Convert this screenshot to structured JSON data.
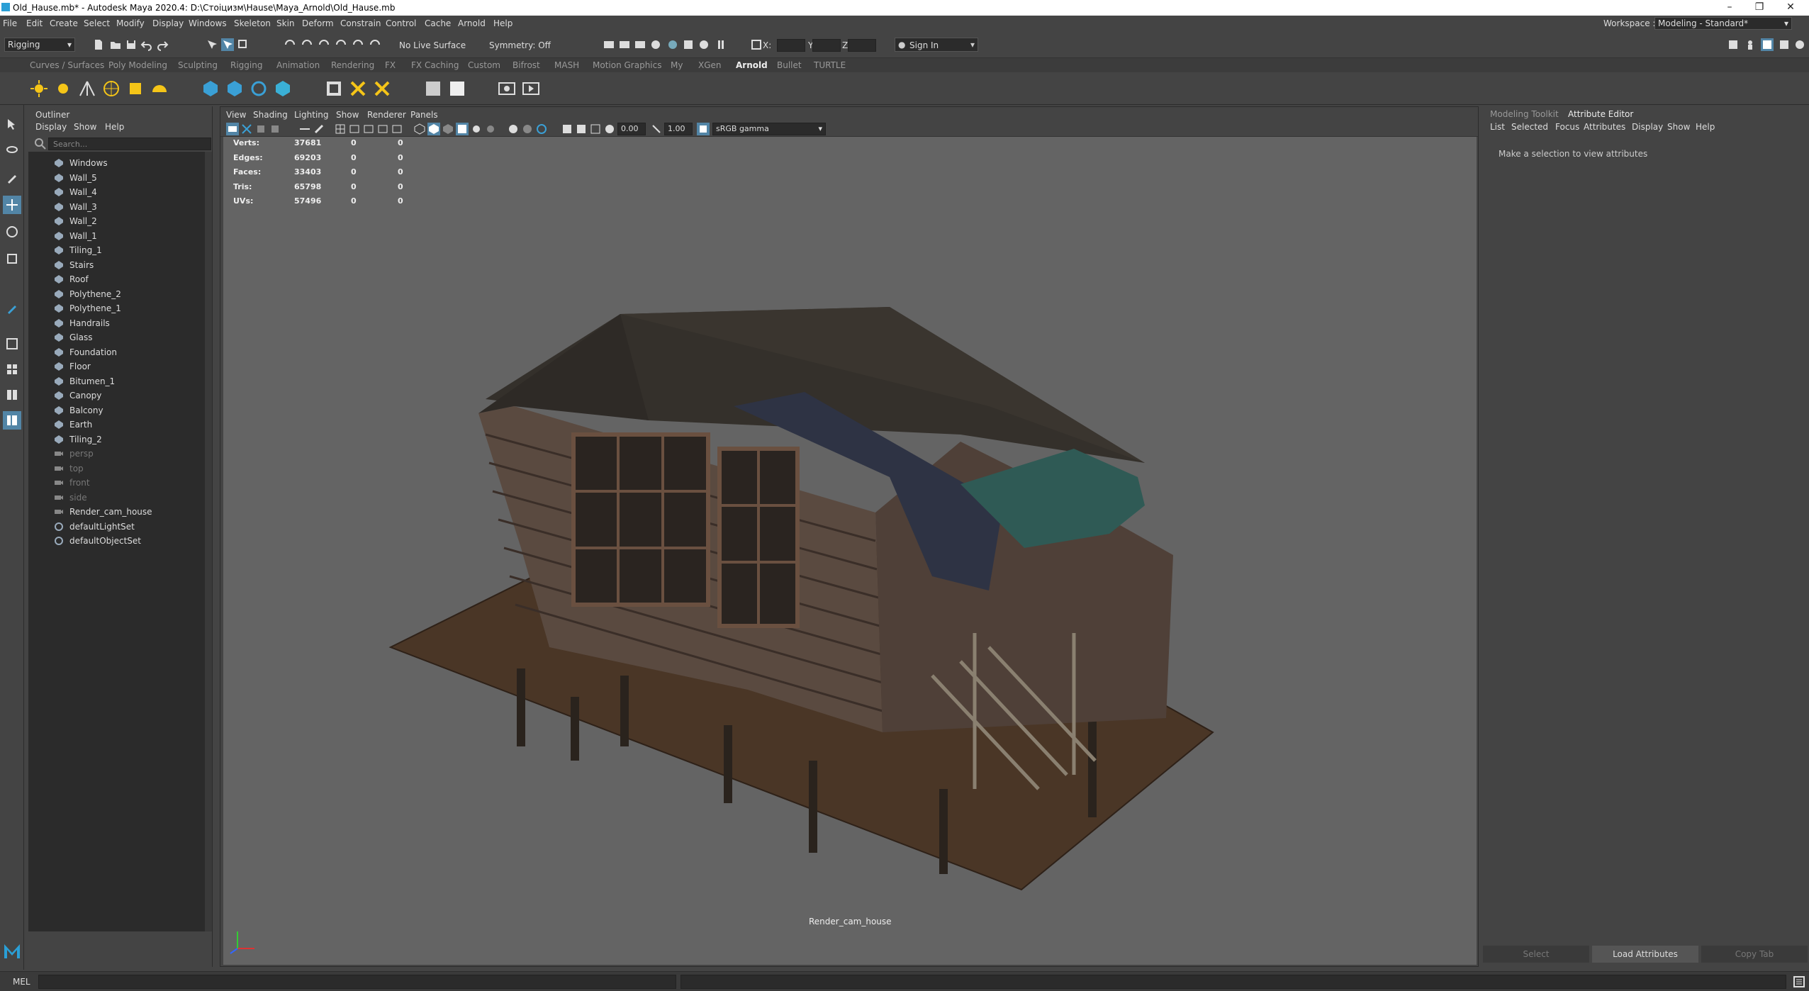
{
  "window": {
    "title": "Old_Hause.mb* - Autodesk Maya 2020.4: D:\\Стоіцизм\\Hause\\Maya_Arnold\\Old_Hause.mb"
  },
  "menubar": {
    "items": [
      "File",
      "Edit",
      "Create",
      "Select",
      "Modify",
      "Display",
      "Windows",
      "Skeleton",
      "Skin",
      "Deform",
      "Constrain",
      "Control",
      "Cache",
      "Arnold",
      "Help"
    ],
    "workspace_label": "Workspace :",
    "workspace_value": "Modeling - Standard*"
  },
  "statusline": {
    "mode": "Rigging",
    "live_surface": "No Live Surface",
    "symmetry": "Symmetry: Off",
    "x_label": "X:",
    "y_label": "Y:",
    "z_label": "Z:",
    "sign_in": "Sign In"
  },
  "shelf_tabs": [
    "Curves / Surfaces",
    "Poly Modeling",
    "Sculpting",
    "Rigging",
    "Animation",
    "Rendering",
    "FX",
    "FX Caching",
    "Custom",
    "Bifrost",
    "MASH",
    "Motion Graphics",
    "My",
    "XGen",
    "Arnold",
    "Bullet",
    "TURTLE"
  ],
  "active_shelf_tab": "Arnold",
  "outliner": {
    "title": "Outliner",
    "menus": [
      "Display",
      "Show",
      "Help"
    ],
    "search_placeholder": "Search...",
    "items": [
      {
        "name": "Windows",
        "type": "mesh"
      },
      {
        "name": "Wall_5",
        "type": "mesh"
      },
      {
        "name": "Wall_4",
        "type": "mesh"
      },
      {
        "name": "Wall_3",
        "type": "mesh"
      },
      {
        "name": "Wall_2",
        "type": "mesh"
      },
      {
        "name": "Wall_1",
        "type": "mesh"
      },
      {
        "name": "Tiling_1",
        "type": "mesh"
      },
      {
        "name": "Stairs",
        "type": "mesh"
      },
      {
        "name": "Roof",
        "type": "mesh"
      },
      {
        "name": "Polythene_2",
        "type": "mesh"
      },
      {
        "name": "Polythene_1",
        "type": "mesh"
      },
      {
        "name": "Handrails",
        "type": "mesh"
      },
      {
        "name": "Glass",
        "type": "mesh"
      },
      {
        "name": "Foundation",
        "type": "mesh"
      },
      {
        "name": "Floor",
        "type": "mesh"
      },
      {
        "name": "Bitumen_1",
        "type": "mesh"
      },
      {
        "name": "Canopy",
        "type": "mesh"
      },
      {
        "name": "Balcony",
        "type": "mesh"
      },
      {
        "name": "Earth",
        "type": "mesh"
      },
      {
        "name": "Tiling_2",
        "type": "mesh"
      },
      {
        "name": "persp",
        "type": "camera"
      },
      {
        "name": "top",
        "type": "camera"
      },
      {
        "name": "front",
        "type": "camera"
      },
      {
        "name": "side",
        "type": "camera"
      },
      {
        "name": "Render_cam_house",
        "type": "camera-active"
      },
      {
        "name": "defaultLightSet",
        "type": "set"
      },
      {
        "name": "defaultObjectSet",
        "type": "set"
      }
    ]
  },
  "viewport": {
    "menus": [
      "View",
      "Shading",
      "Lighting",
      "Show",
      "Renderer",
      "Panels"
    ],
    "exposure": "0.00",
    "gamma": "1.00",
    "color_space": "sRGB gamma",
    "camera_name": "Render_cam_house",
    "hud": [
      {
        "label": "Verts:",
        "a": "37681",
        "b": "0",
        "c": "0"
      },
      {
        "label": "Edges:",
        "a": "69203",
        "b": "0",
        "c": "0"
      },
      {
        "label": "Faces:",
        "a": "33403",
        "b": "0",
        "c": "0"
      },
      {
        "label": "Tris:",
        "a": "65798",
        "b": "0",
        "c": "0"
      },
      {
        "label": "UVs:",
        "a": "57496",
        "b": "0",
        "c": "0"
      }
    ]
  },
  "right_panel": {
    "tabs": [
      "Modeling Toolkit",
      "Attribute Editor"
    ],
    "menus": [
      "List",
      "Selected",
      "Focus",
      "Attributes",
      "Display",
      "Show",
      "Help"
    ],
    "message": "Make a selection to view attributes",
    "buttons": [
      "Select",
      "Load Attributes",
      "Copy Tab"
    ]
  },
  "cmdline": {
    "label": "MEL"
  },
  "colors": {
    "accent": "#5285a6",
    "viewport_bg": "#646464",
    "panel_bg": "#444444"
  }
}
